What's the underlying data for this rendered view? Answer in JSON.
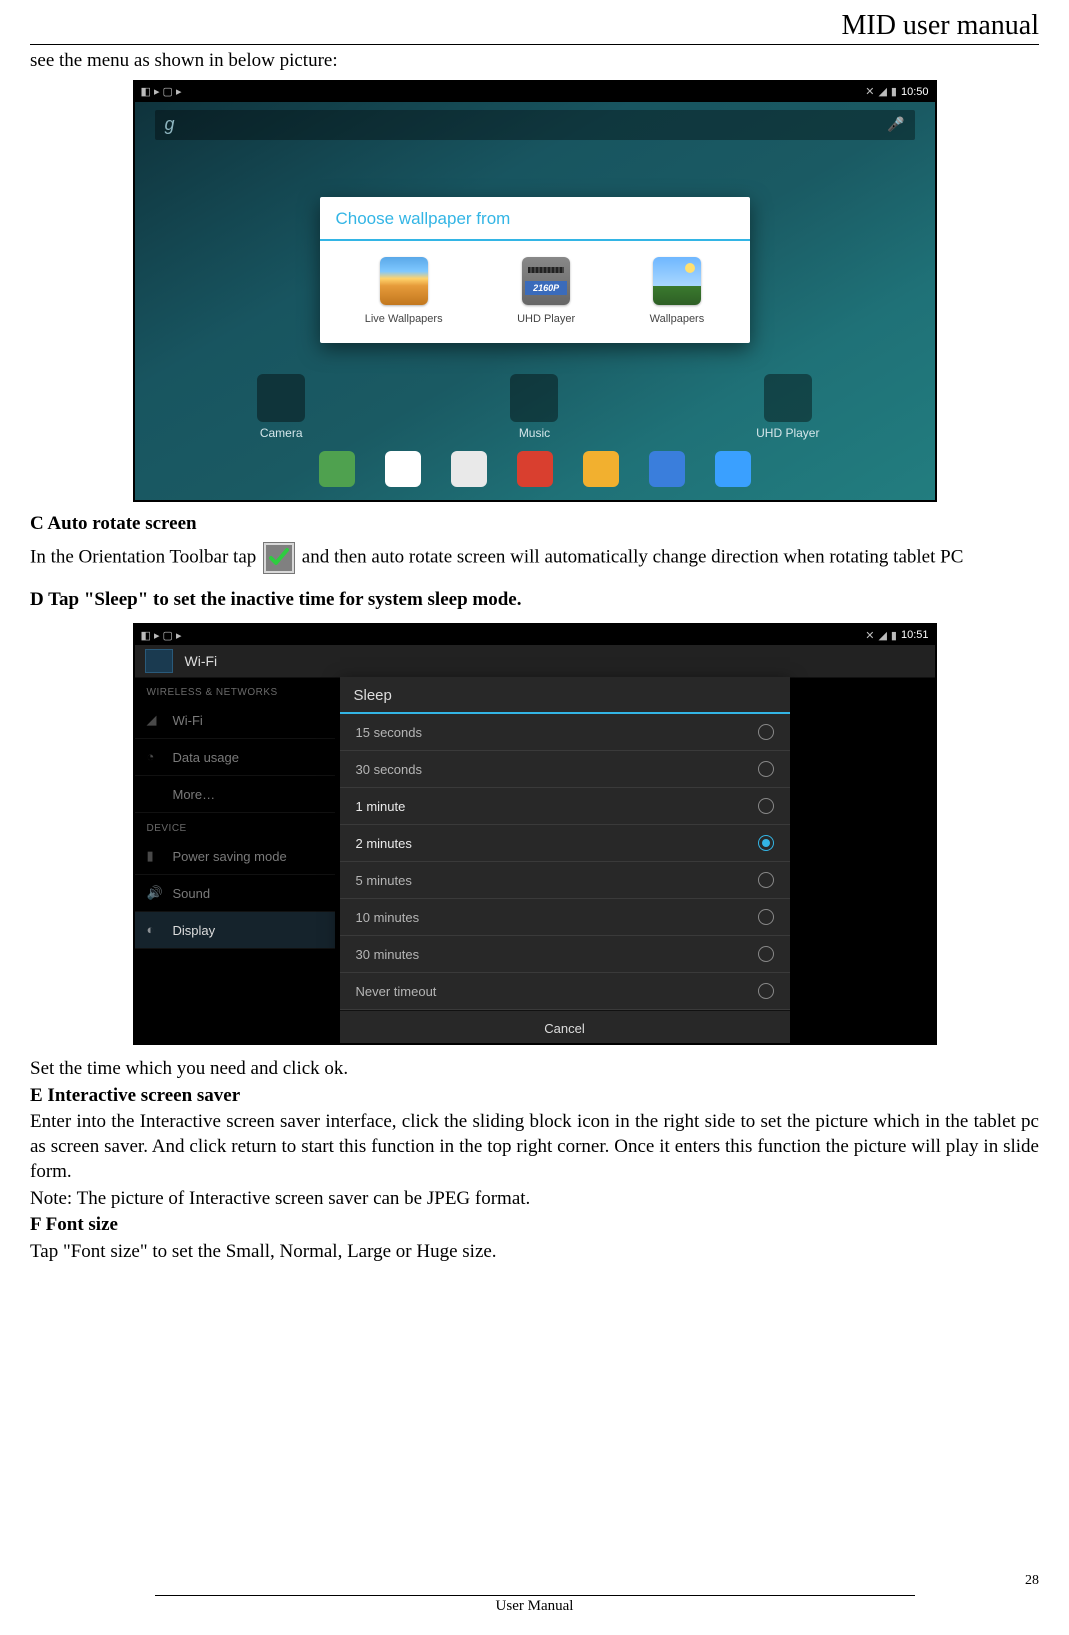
{
  "header": {
    "title": "MID user manual"
  },
  "intro_line": "see the menu as shown in below picture:",
  "screenshot1": {
    "statusbar": {
      "time": "10:50"
    },
    "search": {
      "logo": "g",
      "mic": "🎤"
    },
    "dialog": {
      "title": "Choose wallpaper from",
      "options": [
        {
          "label": "Live Wallpapers",
          "icon": "live"
        },
        {
          "label": "UHD Player",
          "icon": "uhd",
          "badge": "2160P"
        },
        {
          "label": "Wallpapers",
          "icon": "wall"
        }
      ]
    },
    "home_apps": [
      {
        "label": "Camera"
      },
      {
        "label": "Music"
      },
      {
        "label": "UHD Player"
      }
    ]
  },
  "section_c": {
    "heading": "C Auto rotate screen",
    "text_before": "In  the  Orientation  Toolbar  tap",
    "text_after": "and  then  auto  rotate  screen  will  automatically  change  direction when rotating tablet PC"
  },
  "section_d": {
    "heading": "D Tap \"Sleep\" to set the inactive time for system sleep mode."
  },
  "screenshot2": {
    "statusbar": {
      "time": "10:51"
    },
    "header": "Wi-Fi",
    "sidebar": {
      "section1": "WIRELESS & NETWORKS",
      "items1": [
        {
          "label": "Wi-Fi",
          "icon": "wifi"
        },
        {
          "label": "Data usage",
          "icon": "data"
        },
        {
          "label": "More…",
          "icon": ""
        }
      ],
      "section2": "DEVICE",
      "items2": [
        {
          "label": "Power saving mode",
          "icon": "battery"
        },
        {
          "label": "Sound",
          "icon": "sound"
        },
        {
          "label": "Display",
          "icon": "display",
          "selected": true
        }
      ]
    },
    "dialog": {
      "title": "Sleep",
      "options": [
        {
          "label": "15 seconds",
          "selected": false,
          "dim": true
        },
        {
          "label": "30 seconds",
          "selected": false,
          "dim": true
        },
        {
          "label": "1 minute",
          "selected": false,
          "dim": false
        },
        {
          "label": "2 minutes",
          "selected": true,
          "dim": false
        },
        {
          "label": "5 minutes",
          "selected": false,
          "dim": true
        },
        {
          "label": "10 minutes",
          "selected": false,
          "dim": true
        },
        {
          "label": "30 minutes",
          "selected": false,
          "dim": true
        },
        {
          "label": "Never timeout",
          "selected": false,
          "dim": true
        }
      ],
      "cancel": "Cancel"
    }
  },
  "after_shot2": "Set the time which you need and click ok.",
  "section_e": {
    "heading": "E Interactive screen saver",
    "body": "Enter into the Interactive screen saver interface, click the sliding block icon in the right side to set the picture which in the tablet pc as screen saver. And click return to start this function in the top right corner. Once it enters this function the picture will play in slide form.",
    "note": "Note: The picture of Interactive screen saver can be JPEG format."
  },
  "section_f": {
    "heading": "F Font size",
    "body": "Tap \"Font size\" to set the Small, Normal, Large or Huge size."
  },
  "footer": {
    "page": "28",
    "label": "User Manual"
  }
}
